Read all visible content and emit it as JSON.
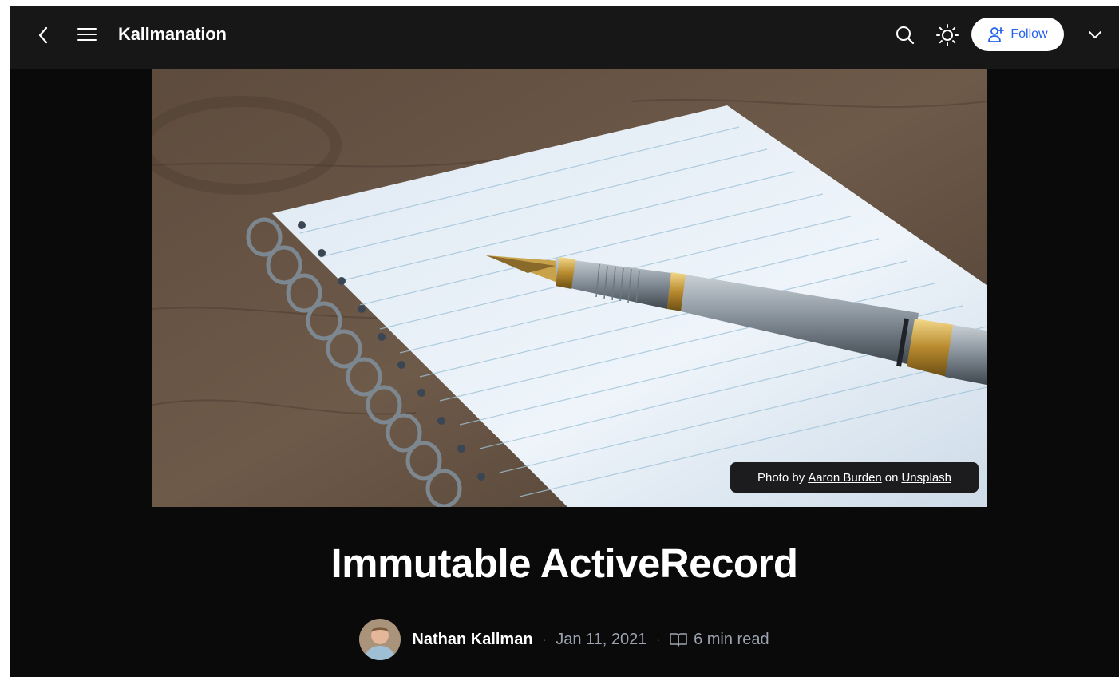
{
  "header": {
    "brand": "Kallmanation",
    "follow_label": "Follow",
    "icons": [
      "chevron-left-icon",
      "hamburger-menu-icon",
      "search-icon",
      "sun-icon",
      "user-plus-icon",
      "chevron-down-icon"
    ]
  },
  "hero": {
    "credit_prefix": "Photo by",
    "credit_author": "Aaron Burden",
    "credit_middle": "on",
    "credit_source": "Unsplash"
  },
  "article": {
    "title": "Immutable ActiveRecord",
    "author": "Nathan Kallman",
    "date": "Jan 11, 2021",
    "read_time": "6 min read",
    "separator": "·"
  },
  "colors": {
    "background": "#0a0a0b",
    "header": "#171717",
    "accent": "#2563eb",
    "meta_text": "#9ca3af"
  }
}
